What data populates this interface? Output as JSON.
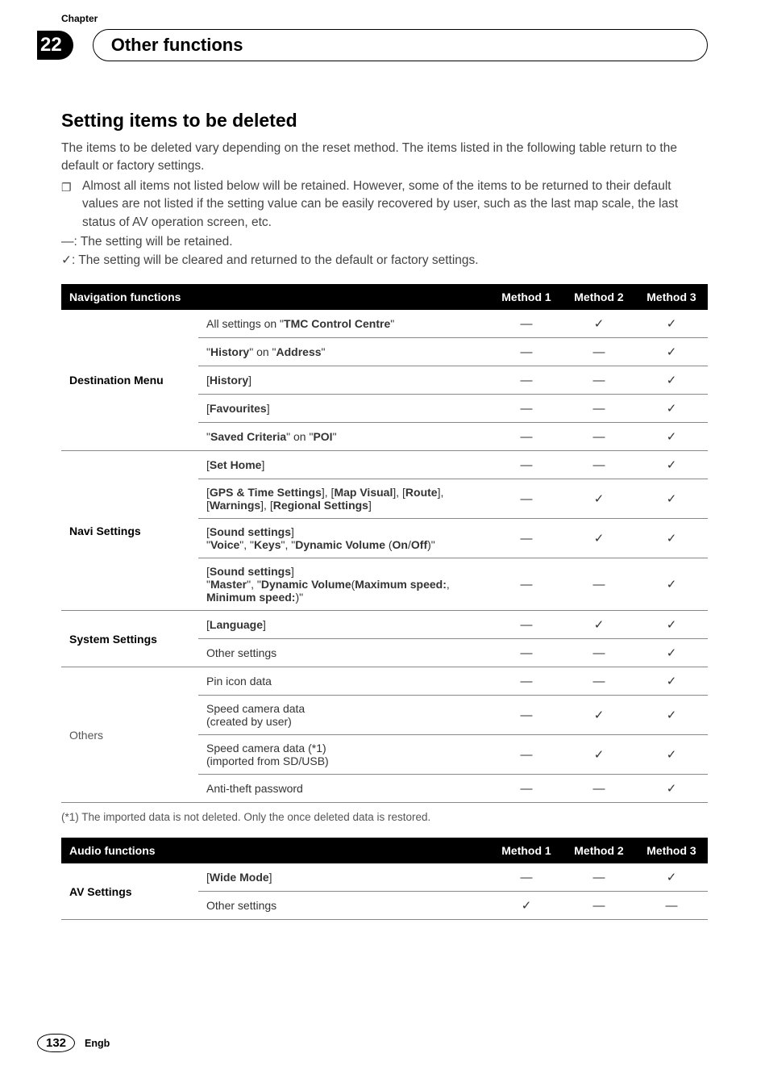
{
  "chapter": {
    "label": "Chapter",
    "number": "22",
    "title": "Other functions"
  },
  "section": {
    "title": "Setting items to be deleted",
    "intro": "The items to be deleted vary depending on the reset method. The items listed in the following table return to the default or factory settings.",
    "bullet": "Almost all items not listed below will be retained. However, some of the items to be returned to their default values are not listed if the setting value can be easily recovered by user, such as the last map scale, the last status of AV operation screen, etc.",
    "legend1": "—: The setting will be retained.",
    "legend2": "✓: The setting will be cleared and returned to the default or factory settings."
  },
  "tableNav": {
    "header": {
      "left": "Navigation functions",
      "m1": "Method 1",
      "m2": "Method 2",
      "m3": "Method 3"
    }
  },
  "navGroups": {
    "dest": "Destination Menu",
    "navi": "Navi Settings",
    "sys": "System Settings",
    "others": "Others"
  },
  "navRows": {
    "r1": {
      "desc_pre": "All settings on \"",
      "desc_bold": "TMC Control Centre",
      "desc_post": "\"",
      "m1": "—",
      "m2": "✓",
      "m3": "✓"
    },
    "r2": {
      "desc": "\"History\" on \"Address\"",
      "m1": "—",
      "m2": "—",
      "m3": "✓"
    },
    "r3": {
      "desc": "[History]",
      "m1": "—",
      "m2": "—",
      "m3": "✓"
    },
    "r4": {
      "desc": "[Favourites]",
      "m1": "—",
      "m2": "—",
      "m3": "✓"
    },
    "r5": {
      "desc": "\"Saved Criteria\" on \"POI\"",
      "m1": "—",
      "m2": "—",
      "m3": "✓"
    },
    "r6": {
      "desc": "[Set Home]",
      "m1": "—",
      "m2": "—",
      "m3": "✓"
    },
    "r7": {
      "desc": "[GPS & Time Settings], [Map Visual], [Route], [Warnings], [Regional Settings]",
      "m1": "—",
      "m2": "✓",
      "m3": "✓"
    },
    "r8": {
      "desc": "[Sound settings]\n\"Voice\", \"Keys\", \"Dynamic Volume (On/Off)\"",
      "m1": "—",
      "m2": "✓",
      "m3": "✓"
    },
    "r9": {
      "desc": "[Sound settings]\n\"Master\", \"Dynamic Volume(Maximum speed:, Minimum speed:)\"",
      "m1": "—",
      "m2": "—",
      "m3": "✓"
    },
    "r10": {
      "desc": "[Language]",
      "m1": "—",
      "m2": "✓",
      "m3": "✓"
    },
    "r11": {
      "desc": "Other settings",
      "m1": "—",
      "m2": "—",
      "m3": "✓"
    },
    "r12": {
      "desc": "Pin icon data",
      "m1": "—",
      "m2": "—",
      "m3": "✓"
    },
    "r13": {
      "desc": "Speed camera data\n(created by user)",
      "m1": "—",
      "m2": "✓",
      "m3": "✓"
    },
    "r14": {
      "desc": "Speed camera data (*1)\n(imported from SD/USB)",
      "m1": "—",
      "m2": "✓",
      "m3": "✓"
    },
    "r15": {
      "desc": "Anti-theft password",
      "m1": "—",
      "m2": "—",
      "m3": "✓"
    }
  },
  "footnote": "(*1) The imported data is not deleted. Only the once deleted data is restored.",
  "tableAudio": {
    "header": {
      "left": "Audio functions",
      "m1": "Method 1",
      "m2": "Method 2",
      "m3": "Method 3"
    }
  },
  "audioGroups": {
    "av": "AV Settings"
  },
  "audioRows": {
    "a1": {
      "desc": "[Wide Mode]",
      "m1": "—",
      "m2": "—",
      "m3": "✓"
    },
    "a2": {
      "desc": "Other settings",
      "m1": "✓",
      "m2": "—",
      "m3": "—"
    }
  },
  "footer": {
    "page": "132",
    "lang": "Engb"
  }
}
